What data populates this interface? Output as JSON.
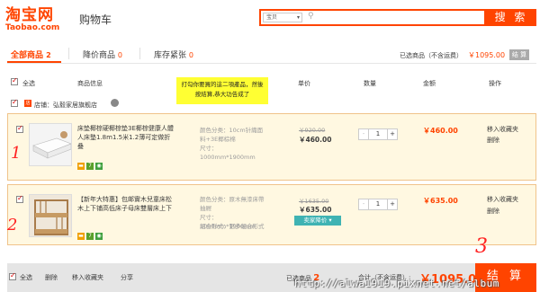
{
  "header": {
    "logo_main": "淘宝网",
    "logo_sub": "Taobao.com",
    "page_title": "购物车",
    "search_scope": "宝贝",
    "search_button": "搜 索"
  },
  "tabs": [
    {
      "label": "全部商品",
      "count": "2"
    },
    {
      "label": "降价商品",
      "count": "0"
    },
    {
      "label": "库存紧张",
      "count": "0"
    }
  ],
  "summary": {
    "selected_label": "已选商品（不含运费）",
    "selected_total": "￥1095.00",
    "settle_small": "结 算"
  },
  "columns": {
    "select_all": "全选",
    "info": "商品信息",
    "price": "单价",
    "qty": "数量",
    "sum": "金额",
    "op": "操作"
  },
  "note": "打勾你要買的這二項產品，然後按結算,恭大功告成了",
  "shop": {
    "label": "店铺：弘毅家居旗舰店"
  },
  "items": [
    {
      "title": "床垫椰棕硬椰棕垫3E椰棕健康人體人床墊1.8m1.5米1.2薄可定做折叠",
      "prop1": "颜色分类：10cm针織面料+3E椰棕棉",
      "prop2": "尺寸：1000mm*1900mm",
      "old_price": "￥920.00",
      "new_price": "￥460.00",
      "qty": "1",
      "sum": "￥460.00",
      "op1": "移入收藏夹",
      "op2": "删除"
    },
    {
      "title": "【新年大特惠】包邮實木兒童床松木上下铺高低床子母床雙層床上下",
      "prop1": "颜色分类：原木無漆床帶抽屜",
      "prop2": "尺寸：1000mm*1900mm",
      "prop3": "組合形式：更多組合形式",
      "old_price": "￥1635.00",
      "new_price": "￥635.00",
      "discount": "卖家降价",
      "qty": "1",
      "sum": "￥635.00",
      "op1": "移入收藏夹",
      "op2": "删除"
    }
  ],
  "marks": {
    "m1": "1",
    "m2": "2",
    "m3": "3"
  },
  "footer": {
    "select_all": "全选",
    "delete": "删除",
    "move_fav": "移入收藏夹",
    "share": "分享",
    "selected_label": "已选商品",
    "selected_count": "2",
    "total_label": "合计（不含运费）:",
    "total": "￥1095.00",
    "checkout": "结 算"
  },
  "watermark": "http://alwa1919.pixnet.net/album"
}
